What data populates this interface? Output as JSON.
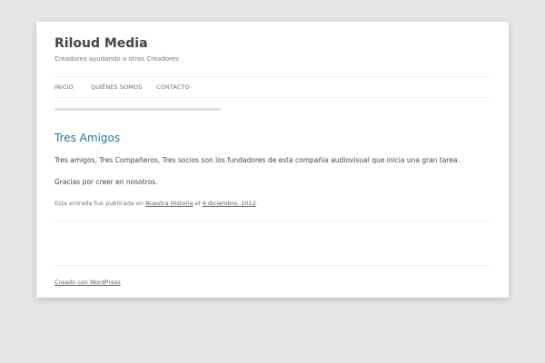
{
  "site": {
    "title": "Riloud Media",
    "description": "Creadores ayudando a otros Creadores"
  },
  "nav": {
    "items": [
      {
        "label": "INICIO"
      },
      {
        "label": "QUIÉNES SOMOS"
      },
      {
        "label": "CONTACTO"
      }
    ]
  },
  "loading_bar": {
    "progress": 1.0,
    "color": "#e0e0e0"
  },
  "post": {
    "title": "Tres Amigos",
    "paragraphs": [
      "Tres amigos, Tres Compañeros, Tres socios son los fundadores de esta compañía audiovisual que inicia una gran tarea.",
      "Gracias por creer en nosotros."
    ],
    "meta": {
      "prefix": "Esta entrada fue publicada en",
      "category": "Nuestra Historia",
      "date_prefix": "el",
      "date": "4 diciembre, 2012",
      "suffix": "."
    }
  },
  "footer": {
    "credit": "Creado con WordPress"
  },
  "colors": {
    "background": "#e6e6e6",
    "page": "#ffffff",
    "link": "#21759b",
    "text": "#444444"
  }
}
